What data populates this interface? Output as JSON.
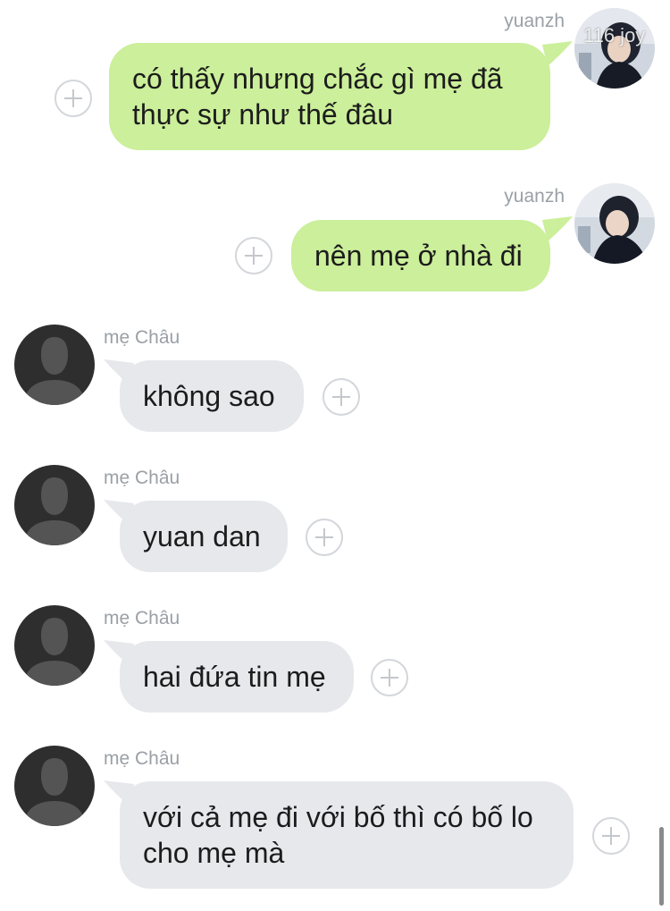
{
  "messages": [
    {
      "sender": "yuanzh",
      "direction": "outgoing",
      "lines": [
        "có thấy nhưng chắc gì mẹ đã",
        "thực sự như thế đâu"
      ],
      "avatar_overlay_text": "116 joy"
    },
    {
      "sender": "yuanzh",
      "direction": "outgoing",
      "lines": [
        "nên mẹ ở nhà đi"
      ]
    },
    {
      "sender": "mẹ Châu",
      "direction": "incoming",
      "lines": [
        "không sao"
      ]
    },
    {
      "sender": "mẹ Châu",
      "direction": "incoming",
      "lines": [
        "yuan dan"
      ]
    },
    {
      "sender": "mẹ Châu",
      "direction": "incoming",
      "lines": [
        "hai đứa tin mẹ"
      ]
    },
    {
      "sender": "mẹ Châu",
      "direction": "incoming",
      "lines": [
        "với cả mẹ đi với bố thì có bố lo",
        "cho mẹ mà"
      ]
    }
  ],
  "icons": {
    "add_reaction": "plus-circle-icon",
    "default_avatar": "person-silhouette-icon",
    "user_avatar": "profile-photo-icon"
  },
  "colors": {
    "outgoing_bubble": "#cbef9a",
    "incoming_bubble": "#e6e8ec",
    "sender_name": "#9aa0a6",
    "default_avatar_bg": "#2e2e2e",
    "default_avatar_figure": "#545454"
  }
}
